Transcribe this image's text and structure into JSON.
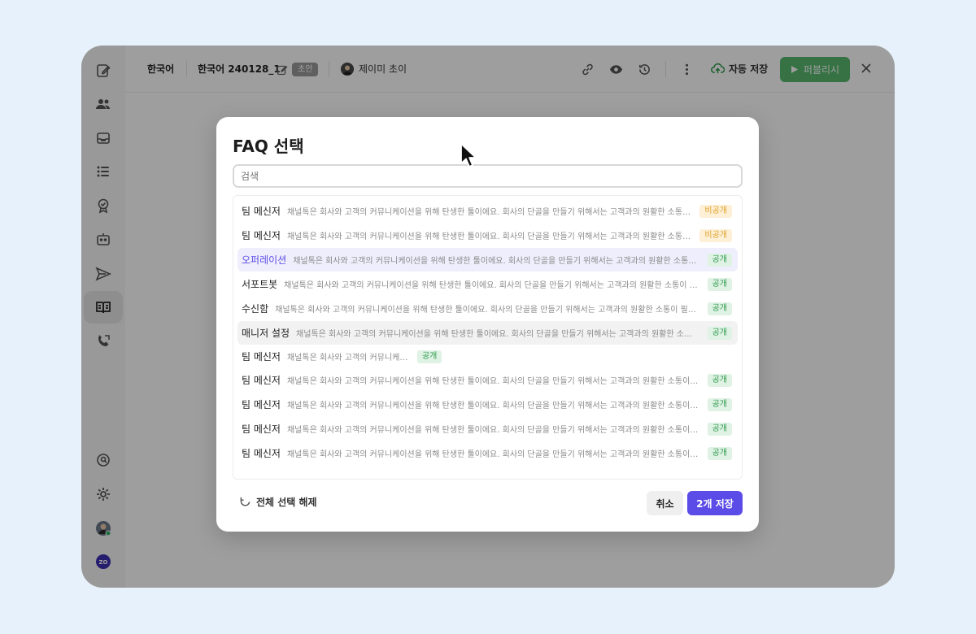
{
  "topbar": {
    "language": "한국어",
    "document_title": "한국어 240128_1",
    "draft_badge": "초안",
    "author": "제이미 초이",
    "autosave_label": "자동 저장",
    "publish_label": "퍼블리시"
  },
  "modal": {
    "title": "FAQ 선택",
    "search_placeholder": "검색",
    "reset_label": "전체 선택 해제",
    "cancel_label": "취소",
    "save_label": "2개 저장",
    "items": [
      {
        "title": "팀 메신저",
        "desc": "채널톡은 회사와 고객의 커뮤니케이션을 위해 탄생한 툴이에요. 회사의 단골을 만들기 위해서는 고객과의 원활한 소통이 필요해요.",
        "badge": "비공개",
        "badge_type": "private",
        "state": "normal"
      },
      {
        "title": "팀 메신저",
        "desc": "채널톡은 회사와 고객의 커뮤니케이션을 위해 탄생한 툴이에요. 회사의 단골을 만들기 위해서는 고객과의 원활한 소통이 필요해요.",
        "badge": "비공개",
        "badge_type": "private",
        "state": "normal"
      },
      {
        "title": "오퍼레이션",
        "desc": "채널톡은 회사와 고객의 커뮤니케이션을 위해 탄생한 툴이에요. 회사의 단골을 만들기 위해서는 고객과의 원활한 소통이 필요해요.",
        "badge": "공개",
        "badge_type": "public",
        "state": "selected"
      },
      {
        "title": "서포트봇",
        "desc": "채널톡은 회사와 고객의 커뮤니케이션을 위해 탄생한 툴이에요. 회사의 단골을 만들기 위해서는 고객과의 원활한 소통이 필요해요.",
        "badge": "공개",
        "badge_type": "public",
        "state": "normal"
      },
      {
        "title": "수신함",
        "desc": "채널톡은 회사와 고객의 커뮤니케이션을 위해 탄생한 툴이에요. 회사의 단골을 만들기 위해서는 고객과의 원활한 소통이 필요해요.",
        "badge": "공개",
        "badge_type": "public",
        "state": "normal"
      },
      {
        "title": "매니저 설정",
        "desc": "채널톡은 회사와 고객의 커뮤니케이션을 위해 탄생한 툴이에요. 회사의 단골을 만들기 위해서는 고객과의 원활한 소통이 필요해요.",
        "badge": "공개",
        "badge_type": "public",
        "state": "hover"
      },
      {
        "title": "팀 메신저",
        "desc": "채널톡은 회사와 고객의 커뮤니케이션을 위해 탄생한 툴이에요.",
        "badge": "공개",
        "badge_type": "public",
        "state": "short"
      },
      {
        "title": "팀 메신저",
        "desc": "채널톡은 회사와 고객의 커뮤니케이션을 위해 탄생한 툴이에요. 회사의 단골을 만들기 위해서는 고객과의 원활한 소통이 필요해요.",
        "badge": "공개",
        "badge_type": "public",
        "state": "normal"
      },
      {
        "title": "팀 메신저",
        "desc": "채널톡은 회사와 고객의 커뮤니케이션을 위해 탄생한 툴이에요. 회사의 단골을 만들기 위해서는 고객과의 원활한 소통이 필요해요.",
        "badge": "공개",
        "badge_type": "public",
        "state": "normal"
      },
      {
        "title": "팀 메신저",
        "desc": "채널톡은 회사와 고객의 커뮤니케이션을 위해 탄생한 툴이에요. 회사의 단골을 만들기 위해서는 고객과의 원활한 소통이 필요해요.",
        "badge": "공개",
        "badge_type": "public",
        "state": "normal"
      },
      {
        "title": "팀 메신저",
        "desc": "채널톡은 회사와 고객의 커뮤니케이션을 위해 탄생한 툴이에요. 회사의 단골을 만들기 위해서는 고객과의 원활한 소통이 필요해요.",
        "badge": "공개",
        "badge_type": "public",
        "state": "normal"
      }
    ]
  },
  "colors": {
    "accent": "#5b4ce8",
    "publish_green": "#57b96e",
    "public_badge": "#2f9a4c",
    "private_badge": "#e0a22a"
  },
  "icons": {
    "sidebar": [
      "compose-icon",
      "users-icon",
      "inbox-icon",
      "list-icon",
      "badge-check-icon",
      "bot-icon",
      "send-icon",
      "book-icon",
      "phone-icon",
      "chat-search-icon",
      "gear-icon",
      "user-avatar",
      "workspace-logo"
    ],
    "topbar": [
      "link-icon",
      "eye-icon",
      "history-icon",
      "more-icon",
      "cloud-upload-icon",
      "play-icon",
      "close-icon"
    ]
  }
}
